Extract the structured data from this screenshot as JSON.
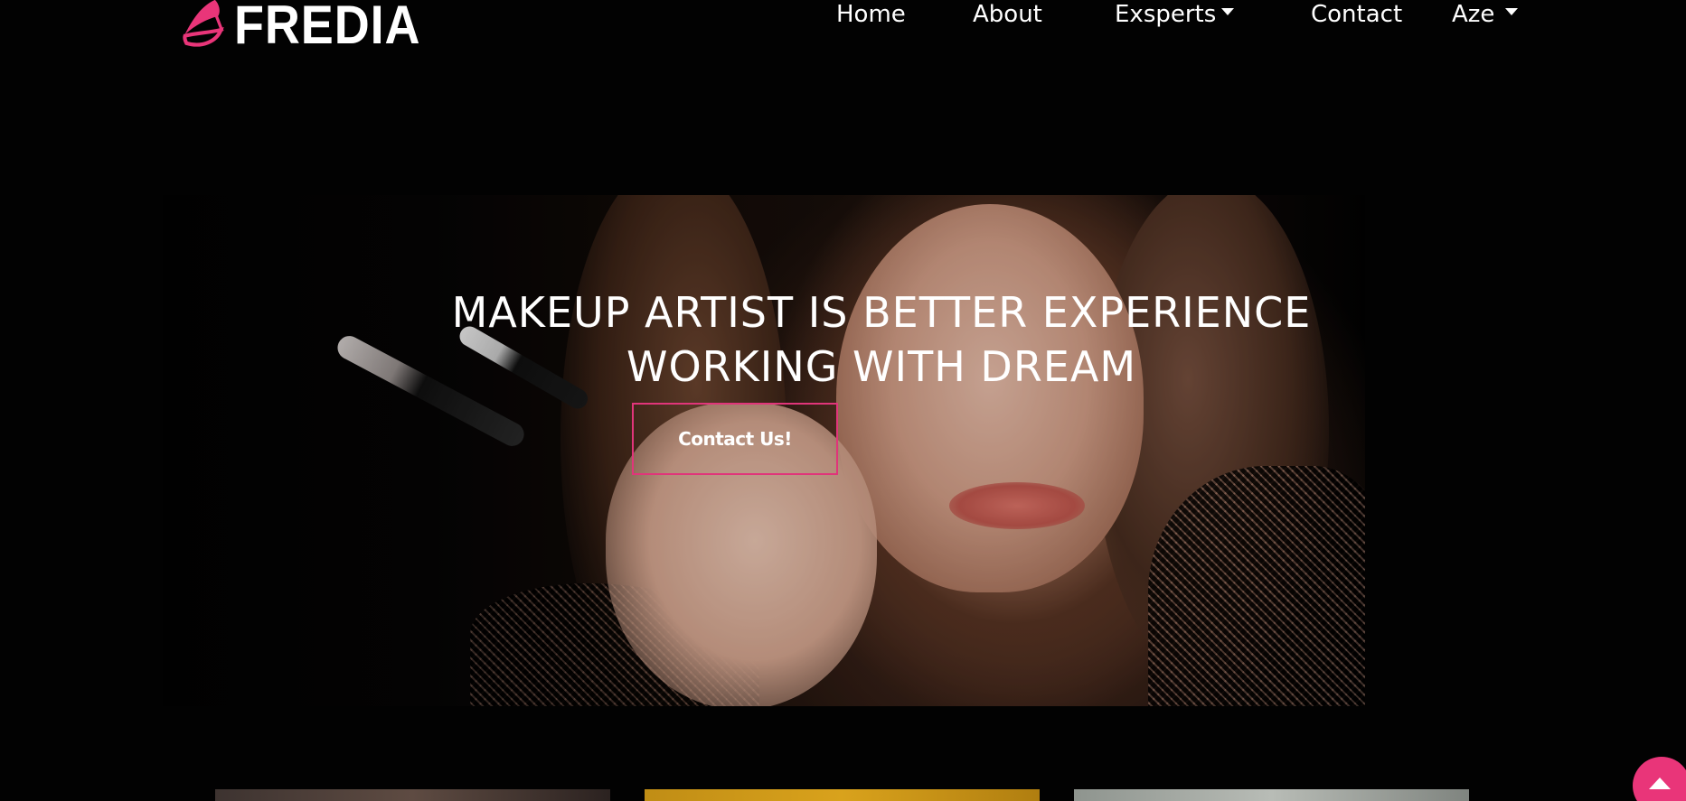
{
  "brand": {
    "name": "FREDIA",
    "logo_icon": "butterfly-icon",
    "accent_color": "#e93579"
  },
  "nav": {
    "items": [
      {
        "label": "Home",
        "has_dropdown": false
      },
      {
        "label": "About",
        "has_dropdown": false
      },
      {
        "label": "Exsperts",
        "has_dropdown": true
      },
      {
        "label": "Contact",
        "has_dropdown": false
      },
      {
        "label": "Aze",
        "has_dropdown": true
      }
    ]
  },
  "hero": {
    "title": "MAKEUP ARTIST IS BETTER EXPERIENCE WORKING WITH DREAM",
    "cta_label": "Contact Us!",
    "image": "makeup-artist-portrait"
  },
  "cards": [
    {
      "image": "card-image-1"
    },
    {
      "image": "card-image-2"
    },
    {
      "image": "card-image-3"
    }
  ],
  "scroll_top": {
    "icon": "arrow-up-icon"
  }
}
